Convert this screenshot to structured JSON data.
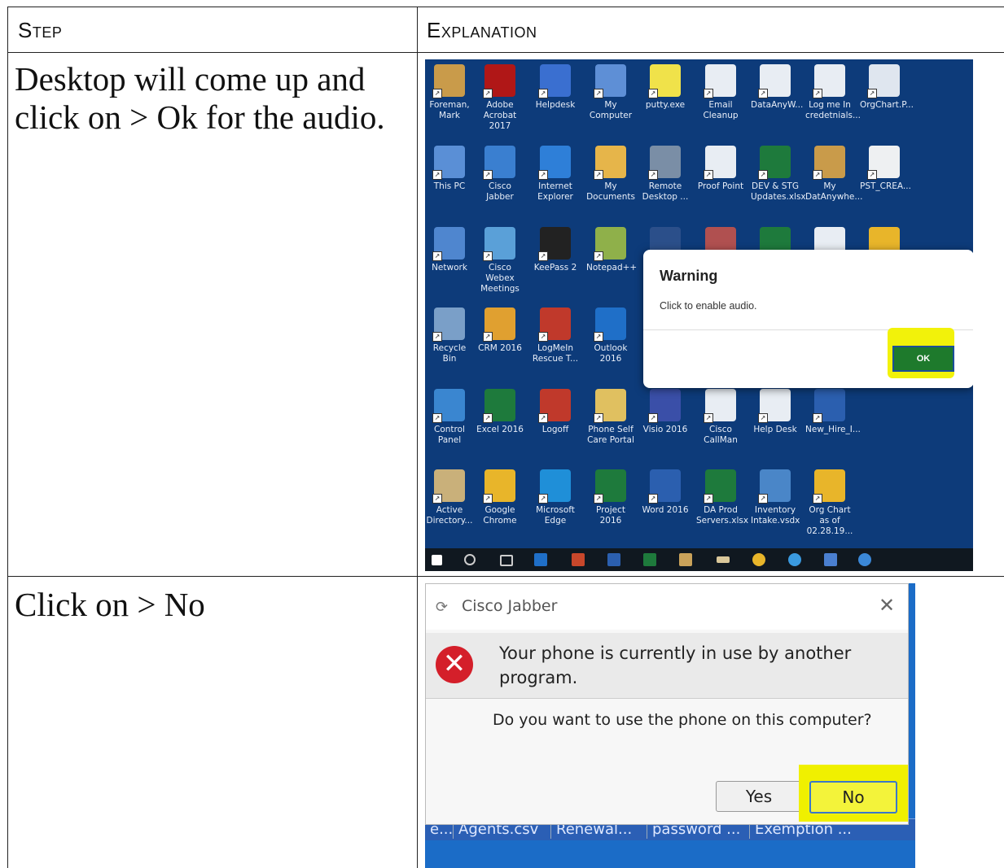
{
  "table": {
    "header_step": "Step",
    "header_explanation": "Explanation"
  },
  "rows": [
    {
      "step": "Desktop will come up and click on > Ok for the audio."
    },
    {
      "step": "Click on > No"
    }
  ],
  "desktop": {
    "icons": [
      "Foreman, Mark",
      "Adobe Acrobat 2017",
      "Helpdesk",
      "My Computer",
      "putty.exe",
      "Email Cleanup",
      "DataAnyW...",
      "Log me In credetnials...",
      "OrgChart.P...",
      "This PC",
      "Cisco Jabber",
      "Internet Explorer",
      "My Documents",
      "Remote Desktop ...",
      "Proof Point",
      "DEV & STG Updates.xlsx",
      "My DatAnywhe...",
      "PST_CREA...",
      "Network",
      "Cisco Webex Meetings",
      "KeePass 2",
      "Notepad++",
      "Recycle Bin",
      "CRM 2016",
      "LogMeIn Rescue T...",
      "Outlook 2016",
      "Control Panel",
      "Excel 2016",
      "Logoff",
      "Phone Self Care Portal",
      "Visio 2016",
      "Cisco CallMan",
      "Help Desk",
      "New_Hire_I...",
      "Active Directory...",
      "Google Chrome",
      "Microsoft Edge",
      "Project 2016",
      "Word 2016",
      "DA Prod Servers.xlsx",
      "Inventory Intake.vsdx",
      "Org Chart as of 02.28.19..."
    ],
    "warning": {
      "title": "Warning",
      "message": "Click to enable audio.",
      "ok_label": "OK"
    }
  },
  "jabber": {
    "title": "Cisco Jabber",
    "message": "Your phone is currently in use by another program.",
    "question": "Do you want to use the phone on this computer?",
    "yes_label": "Yes",
    "no_label": "No",
    "background_tabs": [
      "e...",
      "Agents.csv",
      "Renewal...",
      "password ...",
      "Exemption ..."
    ]
  },
  "colors": {
    "desktop_bg": "#0d3b7a",
    "highlight": "#f2f20a",
    "ok_button": "#1e7a2c",
    "error_icon": "#d41f2a"
  }
}
